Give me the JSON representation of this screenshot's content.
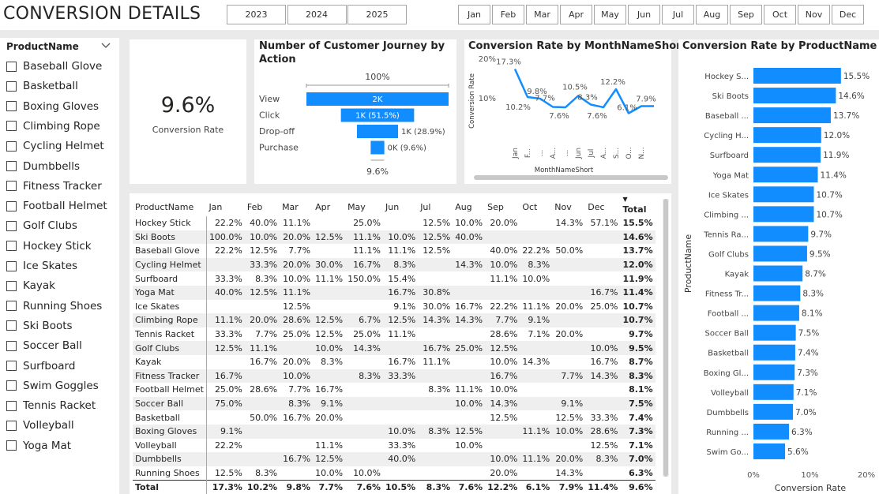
{
  "header": {
    "title": "CONVERSION DETAILS",
    "years": [
      "2023",
      "2024",
      "2025"
    ],
    "months": [
      "Jan",
      "Feb",
      "Mar",
      "Apr",
      "May",
      "Jun",
      "Jul",
      "Aug",
      "Sep",
      "Oct",
      "Nov",
      "Dec"
    ]
  },
  "product_slicer": {
    "header": "ProductName",
    "items": [
      "Baseball Glove",
      "Basketball",
      "Boxing Gloves",
      "Climbing Rope",
      "Cycling Helmet",
      "Dumbbells",
      "Fitness Tracker",
      "Football Helmet",
      "Golf Clubs",
      "Hockey Stick",
      "Ice Skates",
      "Kayak",
      "Running Shoes",
      "Ski Boots",
      "Soccer Ball",
      "Surfboard",
      "Swim Goggles",
      "Tennis Racket",
      "Volleyball",
      "Yoga Mat"
    ]
  },
  "card": {
    "value": "9.6%",
    "label": "Conversion Rate"
  },
  "colors": {
    "accent": "#118dff",
    "dark": "#252423",
    "grid": "#e0e0e0"
  },
  "funnel": {
    "title": "Number of Customer Journey by Action",
    "top_pct": "100%",
    "bottom_pct": "9.6%",
    "stages": [
      {
        "label": "View",
        "value_label": "2K",
        "fraction": 1.0
      },
      {
        "label": "Click",
        "value_label": "1K (51.5%)",
        "fraction": 0.515
      },
      {
        "label": "Drop-off",
        "value_label": "1K (28.9%)",
        "fraction": 0.289
      },
      {
        "label": "Purchase",
        "value_label": "0K (9.6%)",
        "fraction": 0.096
      }
    ]
  },
  "line_chart": {
    "title": "Conversion Rate by MonthNameShort",
    "ylabel": "Conversion Rate",
    "xlabel": "MonthNameShort",
    "yticks": [
      "20%",
      "10%"
    ],
    "x_labels": [
      "Jan",
      "F...",
      "...",
      "A...",
      "...",
      "Jun",
      "Jul",
      "A...",
      "S...",
      "O...",
      "N..."
    ]
  },
  "bar_chart": {
    "title": "Conversion Rate by ProductName",
    "ylabel": "ProductName",
    "xlabel": "Conversion Rate",
    "xticks": [
      "0%",
      "10%",
      "20%"
    ]
  },
  "chart_data": [
    {
      "type": "line",
      "title": "Conversion Rate by MonthNameShort",
      "xlabel": "MonthNameShort",
      "ylabel": "Conversion Rate",
      "categories": [
        "Jan",
        "Feb",
        "Mar",
        "Apr",
        "May",
        "Jun",
        "Jul",
        "Aug",
        "Sep",
        "Oct",
        "Nov",
        "Dec"
      ],
      "values": [
        17.3,
        10.2,
        9.8,
        7.7,
        7.6,
        10.5,
        8.3,
        7.6,
        12.2,
        6.1,
        7.9,
        7.9
      ],
      "value_labels": [
        "17.3%",
        "10.2%",
        "9.8%",
        "7.7%",
        "7.6%",
        "10.5%",
        "8.3%",
        "7.6%",
        "12.2%",
        "6.1%",
        "7.9%",
        ""
      ],
      "ylim": [
        0,
        20
      ]
    },
    {
      "type": "bar",
      "title": "Conversion Rate by ProductName",
      "xlabel": "Conversion Rate",
      "ylabel": "ProductName",
      "categories": [
        "Hockey S...",
        "Ski Boots",
        "Baseball ...",
        "Cycling H...",
        "Surfboard",
        "Yoga Mat",
        "Ice Skates",
        "Climbing ...",
        "Tennis Ra...",
        "Golf Clubs",
        "Kayak",
        "Fitness Tr...",
        "Football ...",
        "Soccer Ball",
        "Basketball",
        "Boxing Gl...",
        "Volleyball",
        "Dumbbells",
        "Running ...",
        "Swim Go..."
      ],
      "values": [
        15.5,
        14.6,
        13.7,
        12.0,
        11.9,
        11.4,
        10.7,
        10.7,
        9.7,
        9.5,
        8.7,
        8.3,
        8.1,
        7.5,
        7.4,
        7.3,
        7.1,
        7.0,
        6.3,
        5.6
      ],
      "xlim": [
        0,
        20
      ]
    }
  ],
  "table": {
    "columns": [
      "ProductName",
      "Jan",
      "Feb",
      "Mar",
      "Apr",
      "May",
      "Jun",
      "Jul",
      "Aug",
      "Sep",
      "Oct",
      "Nov",
      "Dec",
      "Total"
    ],
    "rows": [
      [
        "Hockey Stick",
        "22.2%",
        "40.0%",
        "11.1%",
        "",
        "25.0%",
        "",
        "12.5%",
        "10.0%",
        "20.0%",
        "",
        "14.3%",
        "57.1%",
        "15.5%"
      ],
      [
        "Ski Boots",
        "100.0%",
        "10.0%",
        "20.0%",
        "12.5%",
        "11.1%",
        "10.0%",
        "12.5%",
        "40.0%",
        "",
        "",
        "",
        "",
        "14.6%"
      ],
      [
        "Baseball Glove",
        "22.2%",
        "12.5%",
        "7.7%",
        "",
        "11.1%",
        "11.1%",
        "12.5%",
        "",
        "40.0%",
        "22.2%",
        "50.0%",
        "",
        "13.7%"
      ],
      [
        "Cycling Helmet",
        "",
        "33.3%",
        "20.0%",
        "30.0%",
        "16.7%",
        "8.3%",
        "",
        "14.3%",
        "10.0%",
        "8.3%",
        "",
        "",
        "12.0%"
      ],
      [
        "Surfboard",
        "33.3%",
        "8.3%",
        "10.0%",
        "11.1%",
        "150.0%",
        "15.4%",
        "",
        "",
        "11.1%",
        "10.0%",
        "",
        "",
        "11.9%"
      ],
      [
        "Yoga Mat",
        "40.0%",
        "12.5%",
        "11.1%",
        "",
        "",
        "16.7%",
        "30.8%",
        "",
        "",
        "",
        "",
        "16.7%",
        "11.4%"
      ],
      [
        "Ice Skates",
        "",
        "",
        "12.5%",
        "",
        "",
        "9.1%",
        "30.0%",
        "16.7%",
        "22.2%",
        "11.1%",
        "20.0%",
        "25.0%",
        "10.7%"
      ],
      [
        "Climbing Rope",
        "11.1%",
        "20.0%",
        "28.6%",
        "12.5%",
        "6.7%",
        "12.5%",
        "14.3%",
        "14.3%",
        "7.7%",
        "9.1%",
        "",
        "",
        "10.7%"
      ],
      [
        "Tennis Racket",
        "33.3%",
        "7.7%",
        "25.0%",
        "12.5%",
        "25.0%",
        "11.1%",
        "",
        "",
        "28.6%",
        "7.1%",
        "20.0%",
        "",
        "9.7%"
      ],
      [
        "Golf Clubs",
        "12.5%",
        "11.1%",
        "",
        "10.0%",
        "14.3%",
        "",
        "16.7%",
        "25.0%",
        "12.5%",
        "",
        "",
        "10.0%",
        "9.5%"
      ],
      [
        "Kayak",
        "",
        "16.7%",
        "20.0%",
        "8.3%",
        "",
        "16.7%",
        "11.1%",
        "",
        "10.0%",
        "14.3%",
        "",
        "16.7%",
        "8.7%"
      ],
      [
        "Fitness Tracker",
        "16.7%",
        "",
        "10.0%",
        "",
        "8.3%",
        "33.3%",
        "",
        "",
        "16.7%",
        "",
        "7.7%",
        "14.3%",
        "8.3%"
      ],
      [
        "Football Helmet",
        "25.0%",
        "28.6%",
        "7.7%",
        "16.7%",
        "",
        "",
        "8.3%",
        "11.1%",
        "10.0%",
        "",
        "",
        "",
        "8.1%"
      ],
      [
        "Soccer Ball",
        "75.0%",
        "",
        "8.3%",
        "9.1%",
        "",
        "",
        "",
        "10.0%",
        "14.3%",
        "",
        "9.1%",
        "",
        "7.5%"
      ],
      [
        "Basketball",
        "",
        "50.0%",
        "16.7%",
        "20.0%",
        "",
        "",
        "",
        "",
        "12.5%",
        "",
        "12.5%",
        "33.3%",
        "7.4%"
      ],
      [
        "Boxing Gloves",
        "9.1%",
        "",
        "",
        "",
        "",
        "10.0%",
        "8.3%",
        "12.5%",
        "",
        "11.1%",
        "10.0%",
        "28.6%",
        "7.3%"
      ],
      [
        "Volleyball",
        "22.2%",
        "",
        "",
        "11.1%",
        "",
        "33.3%",
        "",
        "10.0%",
        "",
        "",
        "",
        "12.5%",
        "7.1%"
      ],
      [
        "Dumbbells",
        "",
        "",
        "16.7%",
        "12.5%",
        "",
        "40.0%",
        "",
        "",
        "10.0%",
        "11.1%",
        "20.0%",
        "8.3%",
        "7.0%"
      ],
      [
        "Running Shoes",
        "12.5%",
        "8.3%",
        "",
        "10.0%",
        "10.0%",
        "",
        "",
        "",
        "20.0%",
        "",
        "14.3%",
        "",
        "6.3%"
      ]
    ],
    "total_row": [
      "Total",
      "17.3%",
      "10.2%",
      "9.8%",
      "7.7%",
      "7.6%",
      "10.5%",
      "8.3%",
      "7.6%",
      "12.2%",
      "6.1%",
      "7.9%",
      "11.4%",
      "9.6%"
    ]
  }
}
